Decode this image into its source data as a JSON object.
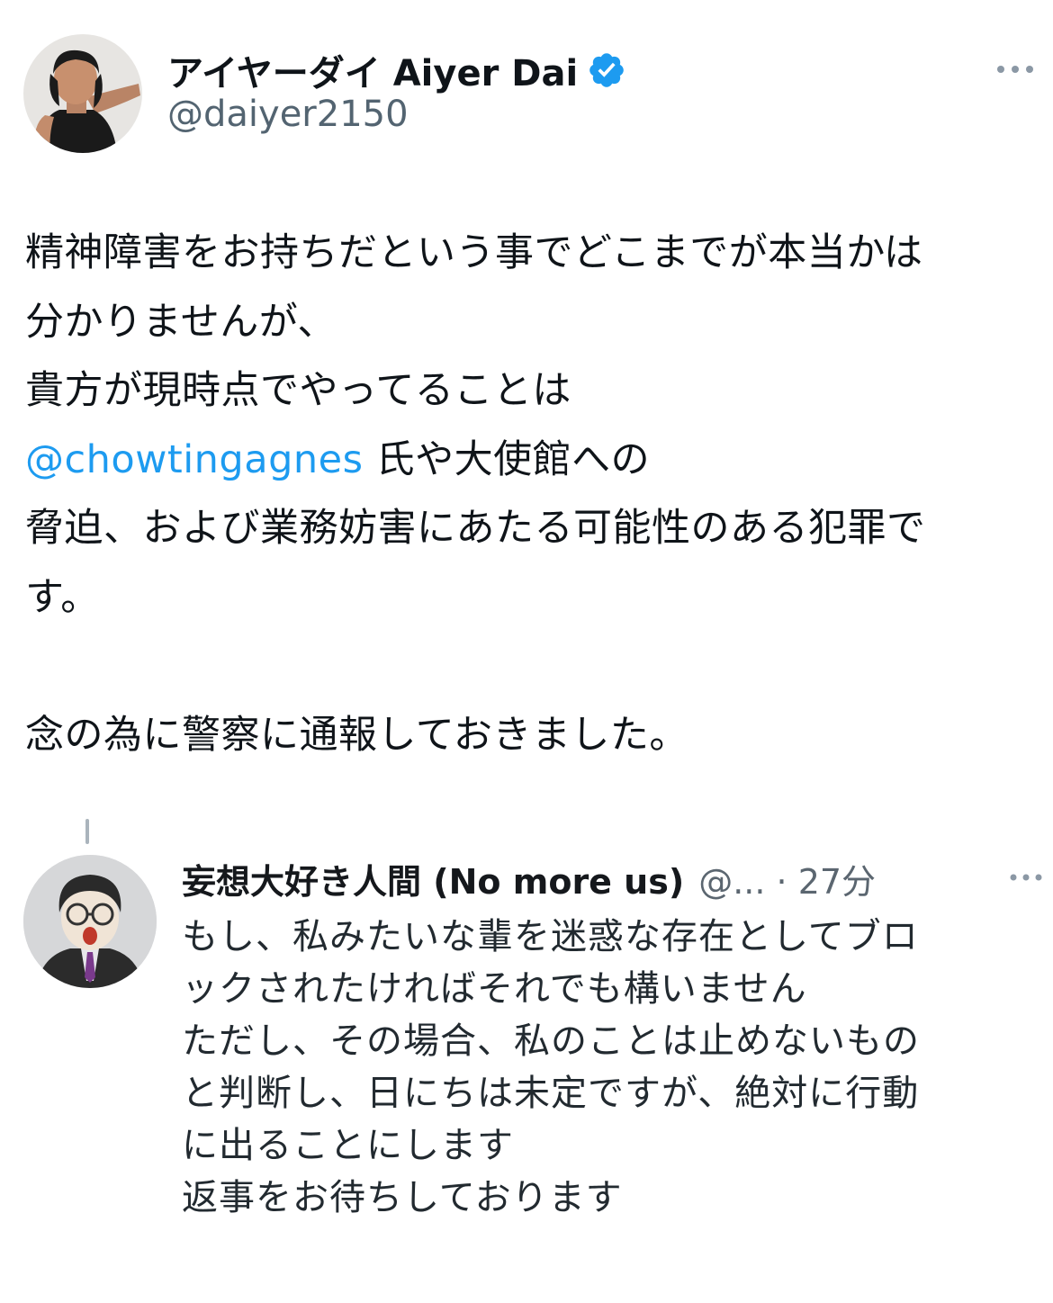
{
  "tweet": {
    "author": {
      "display_name": "アイヤーダイ Aiyer Dai",
      "handle": "@daiyer2150",
      "verified": true,
      "verified_color": "#1d9bf0"
    },
    "more_icon": "more-horizontal-icon",
    "body_lines": [
      {
        "text": "精神障害をお持ちだという事でどこまでが本当かは"
      },
      {
        "text": "分かりませんが、"
      },
      {
        "text": "貴方が現時点でやってることは"
      },
      {
        "mention": "@chowtingagnes",
        "text": " 氏や大使館への"
      },
      {
        "text": "脅迫、および業務妨害にあたる可能性のある犯罪で"
      },
      {
        "text": "す。"
      }
    ],
    "body_lines_2": [
      {
        "text": "念の為に警察に通報しておきました。"
      }
    ],
    "mention_color": "#1d9bf0"
  },
  "embedded_reply": {
    "display_name": "妄想大好き人間 (No more us)",
    "meta": "@... · 27分",
    "body_lines": [
      "もし、私みたいな輩を迷惑な存在としてブロ",
      "ックされたければそれでも構いません",
      "ただし、その場合、私のことは止めないもの",
      "と判断し、日にちは未定ですが、絶対に行動",
      "に出ることにします",
      "返事をお待ちしております"
    ]
  }
}
